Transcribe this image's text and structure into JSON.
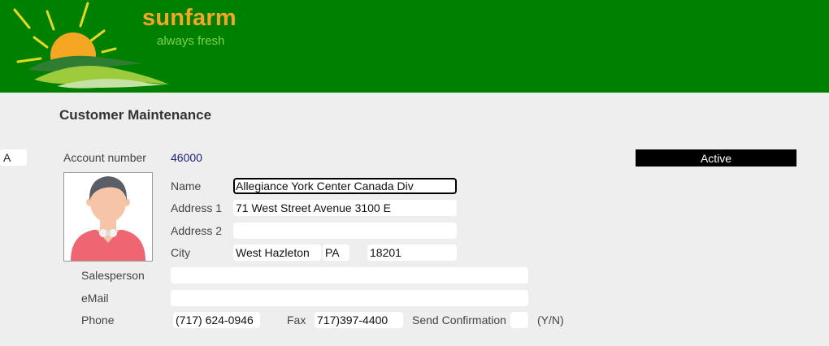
{
  "header": {
    "brand": "sunfarm",
    "tagline": "always fresh"
  },
  "page": {
    "title": "Customer Maintenance"
  },
  "side_field": {
    "value": "A"
  },
  "account": {
    "label": "Account number",
    "number": "46000",
    "status": "Active"
  },
  "form": {
    "name_label": "Name",
    "name": "Allegiance York Center Canada Div",
    "address1_label": "Address 1",
    "address1": "71 West Street Avenue 3100 E",
    "address2_label": "Address 2",
    "address2": "",
    "city_label": "City",
    "city": "West Hazleton",
    "state": "PA",
    "zip": "18201",
    "salesperson_label": "Salesperson",
    "salesperson": "",
    "email_label": "eMail",
    "email": "",
    "phone_label": "Phone",
    "phone": "(717) 624-0946",
    "fax_label": "Fax",
    "fax": "717)397-4400",
    "confirm_label": "Send Confirmation",
    "confirm": "",
    "confirm_hint": "(Y/N)"
  },
  "colors": {
    "header_bg": "#008000",
    "brand": "#f5a623",
    "tagline": "#7fd24a",
    "status_bg": "#000000"
  }
}
